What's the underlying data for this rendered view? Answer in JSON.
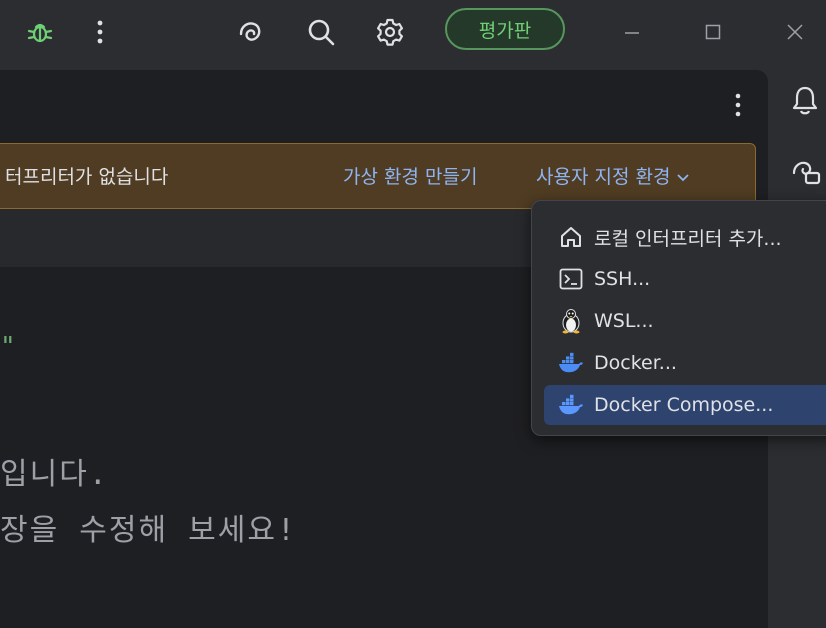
{
  "titlebar": {
    "eval_label": "평가판"
  },
  "banner": {
    "message": "터프리터가 없습니다",
    "create_venv_label": "가상 환경 만들기",
    "custom_env_label": "사용자 지정 환경"
  },
  "editor": {
    "quote": "\"",
    "line1": "입니다.",
    "line2": "장을 수정해 보세요!"
  },
  "popup": {
    "items": [
      {
        "label": "로컬 인터프리터 추가...",
        "icon": "home-icon"
      },
      {
        "label": "SSH...",
        "icon": "terminal-icon"
      },
      {
        "label": "WSL...",
        "icon": "linux-penguin-icon"
      },
      {
        "label": "Docker...",
        "icon": "docker-icon"
      },
      {
        "label": "Docker Compose...",
        "icon": "docker-icon",
        "selected": true
      }
    ]
  },
  "colors": {
    "background": "#2b2d30",
    "editor_background": "#1e1f22",
    "banner_background": "#4f3c22",
    "link": "#8fb4f2",
    "accent_green": "#6fcf75",
    "selection": "#2e436e"
  }
}
